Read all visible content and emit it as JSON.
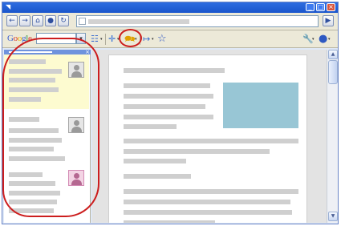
{
  "window": {
    "app_icon": "◥",
    "minimize_glyph": "_",
    "maximize_glyph": "□",
    "close_glyph": "×"
  },
  "nav": {
    "back_glyph": "←",
    "forward_glyph": "→",
    "home_glyph": "⌂",
    "stop_glyph": "●",
    "refresh_glyph": "↻",
    "go_glyph": "▶"
  },
  "google_toolbar": {
    "logo_letters": [
      "G",
      "o",
      "o",
      "g",
      "l",
      "e"
    ],
    "logo_colors": [
      "#3b5fd0",
      "#d9372b",
      "#f0b400",
      "#3b5fd0",
      "#2e9b3c",
      "#d9372b"
    ],
    "dropdown_glyph": "▾",
    "icons": [
      "bookmarks-grid-icon",
      "news-icon",
      "sidebar-note-icon",
      "link-icon",
      "star-icon",
      "wrench-icon",
      "globe-icon"
    ],
    "news_glyph": "✛",
    "note_glyph": "🗪",
    "link_glyph": "↦",
    "star_glyph": "☆",
    "wrench_glyph": "🔧",
    "globe_glyph": "●",
    "grid_glyph": "☷",
    "menu_glyph": "▾"
  },
  "scrollbar": {
    "up_glyph": "▲",
    "down_glyph": "▼"
  },
  "colors": {
    "highlight": "#cc1d1d",
    "note_highlight_bg": "#fdfbd0",
    "image_placeholder": "#98c6d5",
    "sidebar_header": "#6f93dd"
  }
}
